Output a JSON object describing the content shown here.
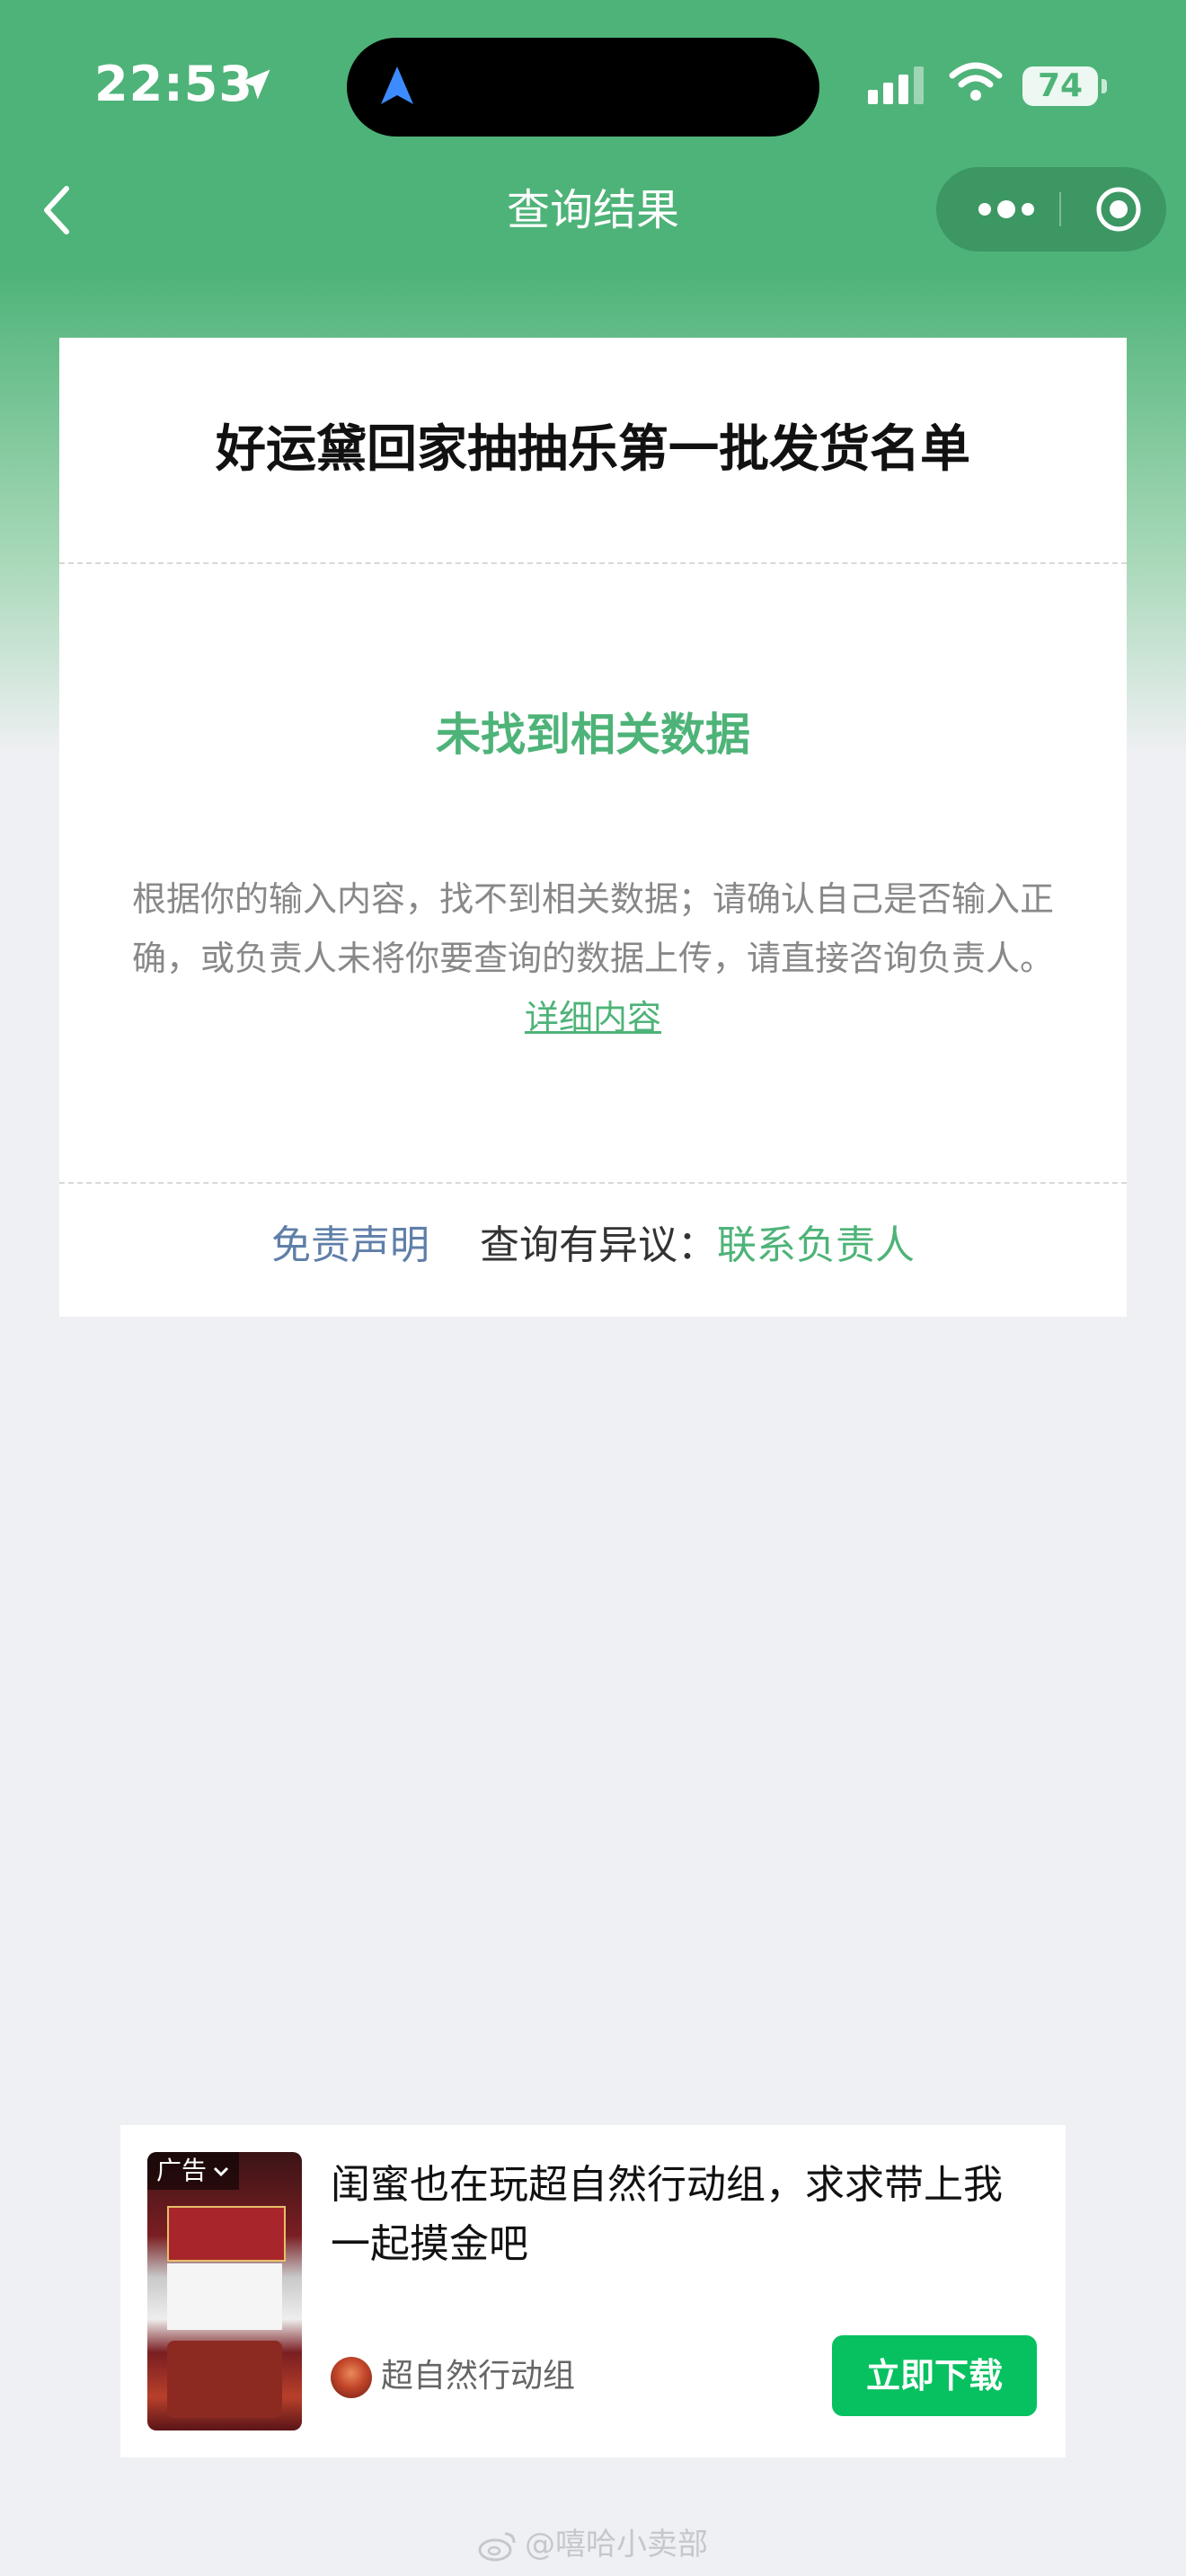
{
  "status_bar": {
    "time": "22:53",
    "battery": "74"
  },
  "nav": {
    "title": "查询结果"
  },
  "card": {
    "title": "好运黛回家抽抽乐第一批发货名单",
    "empty_title": "未找到相关数据",
    "empty_desc": "根据你的输入内容，找不到相关数据；请确认自己是否输入正确，或负责人未将你要查询的数据上传，请直接咨询负责人。",
    "detail_link": "详细内容",
    "disclaimer": "免责声明",
    "dispute_label": "查询有异议：",
    "contact": "联系负责人"
  },
  "ad": {
    "badge": "广告",
    "headline": "闺蜜也在玩超自然行动组，求求带上我一起摸金吧",
    "source": "超自然行动组",
    "cta": "立即下载"
  },
  "watermark": {
    "text": "@嘻哈小卖部"
  },
  "colors": {
    "brand_green": "#4eb378",
    "cta_green": "#07c160",
    "link_blue": "#5f7fa8"
  }
}
